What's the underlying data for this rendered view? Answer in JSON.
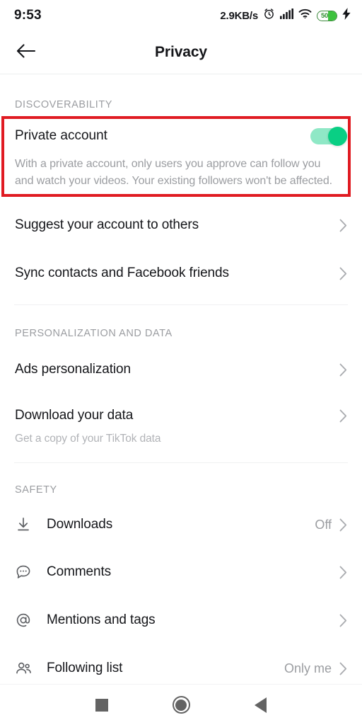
{
  "status_bar": {
    "clock": "9:53",
    "net_speed": "2.9KB/s",
    "alarm_icon": "alarm-clock-icon",
    "signal_icon": "cellular-signal-icon",
    "wifi_icon": "wifi-icon",
    "battery_percent": "50",
    "charging_icon": "charging-bolt-icon",
    "battery_level": 50
  },
  "header": {
    "back_icon": "back-arrow-icon",
    "title": "Privacy"
  },
  "sections": {
    "discoverability": {
      "header": "DISCOVERABILITY",
      "private_account": {
        "title": "Private account",
        "description": "With a private account, only users you approve can follow you and watch your videos. Your existing followers won't be affected.",
        "toggle_state": "on",
        "toggle_color": "#09cf84",
        "highlight_color": "#e01b22"
      },
      "rows": [
        {
          "label": "Suggest your account to others",
          "value": "",
          "icon": ""
        },
        {
          "label": "Sync contacts and Facebook friends",
          "value": "",
          "icon": ""
        }
      ]
    },
    "personalization": {
      "header": "PERSONALIZATION AND DATA",
      "rows": [
        {
          "label": "Ads personalization",
          "value": "",
          "sublabel": "",
          "icon": ""
        },
        {
          "label": "Download your data",
          "value": "",
          "sublabel": "Get a copy of your TikTok data",
          "icon": ""
        }
      ]
    },
    "safety": {
      "header": "SAFETY",
      "rows": [
        {
          "label": "Downloads",
          "value": "Off",
          "icon": "download-icon"
        },
        {
          "label": "Comments",
          "value": "",
          "icon": "comment-bubble-icon"
        },
        {
          "label": "Mentions and tags",
          "value": "",
          "icon": "at-sign-icon"
        },
        {
          "label": "Following list",
          "value": "Only me",
          "icon": "people-icon"
        }
      ]
    }
  },
  "nav_bar": {
    "recents": "recents-square-icon",
    "home": "home-circle-icon",
    "back": "back-triangle-icon"
  }
}
